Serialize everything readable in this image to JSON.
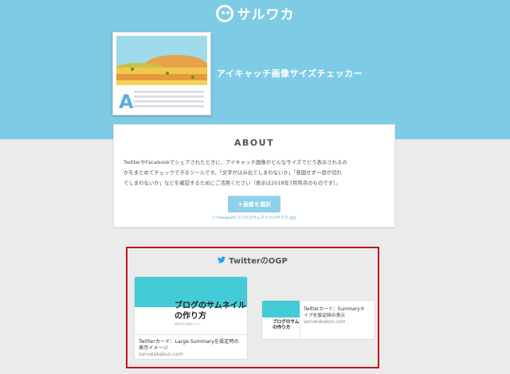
{
  "logo": {
    "text": "サルワカ"
  },
  "app": {
    "title": "アイキャッチ画像サイズチェッカー"
  },
  "about": {
    "heading": "ABOUT",
    "lines": [
      "TwitterやFacebookでシェアされたときに、アイキャッチ画像がどんなサイズでどう表示されるの",
      "かをまとめてチェックできるツールです。「文字がはみ出てしまわないか」「意図せず一部が切れ",
      "てしまわないか」などを確認するためにご活用ください（表示は2018年7月時点のものです）。"
    ],
    "select_button": "＋画像を選択",
    "file_path": "C:\\takapahi\\ブログのサムネイルの作り方.jpg"
  },
  "ogp": {
    "heading": "TwitterのOGP",
    "large_card": {
      "image_title_1": "ブログのサムネイル",
      "image_title_2": "の作り方",
      "image_subtitle": "技術の初心者向けガイド",
      "desc_1": "Twitterカード：Large Summaryを設定時の",
      "desc_2": "表示イメージ",
      "domain": "saruwakakun.com"
    },
    "summary_card": {
      "image_title_1": "ブログのサム",
      "image_title_2": "の作り方",
      "desc_1": "Twitterカード：Summaryタ",
      "desc_2": "イプを設定時の表示",
      "domain": "saruwakakun.com"
    }
  },
  "colors": {
    "hero": "#7ecbe6",
    "accent": "#43ccd8",
    "button": "#8fd0ed",
    "highlight_border": "#c1121c",
    "twitter": "#1da1f2"
  },
  "icons": [
    "saruwaka-logo-icon",
    "twitter-bird-icon",
    "plus-icon",
    "landscape-thumbnail-icon"
  ]
}
